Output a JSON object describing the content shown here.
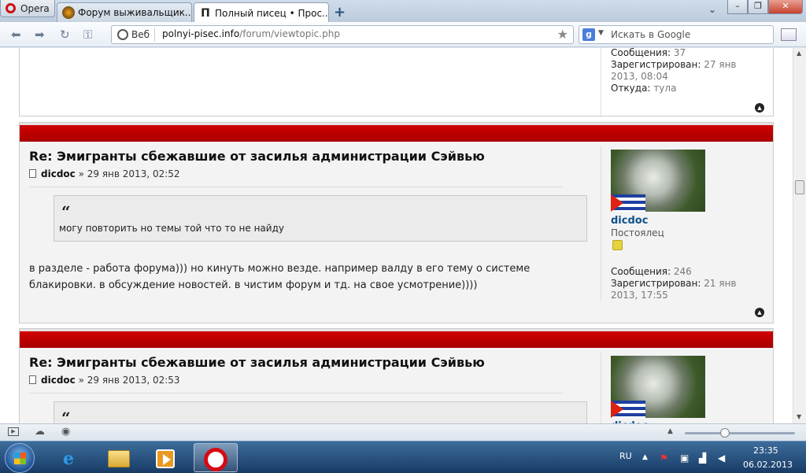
{
  "browser": {
    "menu_label": "Opera",
    "tabs": [
      {
        "title": "Форум выживальщик..."
      },
      {
        "title": "Полный писец • Прос..."
      }
    ],
    "address": {
      "scheme_label": "Веб",
      "domain": "polnyi-pisec.info",
      "path": "/forum/viewtopic.php"
    },
    "search": {
      "placeholder": "Искать в Google",
      "engine_letter": "g"
    }
  },
  "prev_post_profile": {
    "messages_label": "Сообщения:",
    "messages_value": "37",
    "registered_label": "Зарегистрирован:",
    "registered_value": "27 янв 2013, 08:04",
    "from_label": "Откуда:",
    "from_value": "тула"
  },
  "posts": [
    {
      "title": "Re: Эмигранты сбежавшие от засилья администрации Сэйвью",
      "author": "dicdoc",
      "date": "» 29 янв 2013, 02:52",
      "quote_text": "могу повторить но темы той что то не найду",
      "body": "в разделе - работа форума))) но кинуть можно везде. например валду в его тему о системе блакировки. в обсуждение новостей. в чистим форум и тд. на свое усмотрение))))",
      "profile": {
        "name": "dicdoc",
        "rank": "Постоялец",
        "messages_label": "Сообщения:",
        "messages_value": "246",
        "registered_label": "Зарегистрирован:",
        "registered_value": "21 янв 2013, 17:55"
      }
    },
    {
      "title": "Re: Эмигранты сбежавшие от засилья администрации Сэйвью",
      "author": "dicdoc",
      "date": "» 29 янв 2013, 02:53",
      "quote_text": "",
      "profile": {
        "name": "dicdoc"
      }
    }
  ],
  "quote_mark": "“",
  "taskbar": {
    "lang": "RU",
    "time": "23:35",
    "date": "06.02.2013"
  },
  "colors": {
    "post_header": "#c00000",
    "link": "#105289"
  }
}
